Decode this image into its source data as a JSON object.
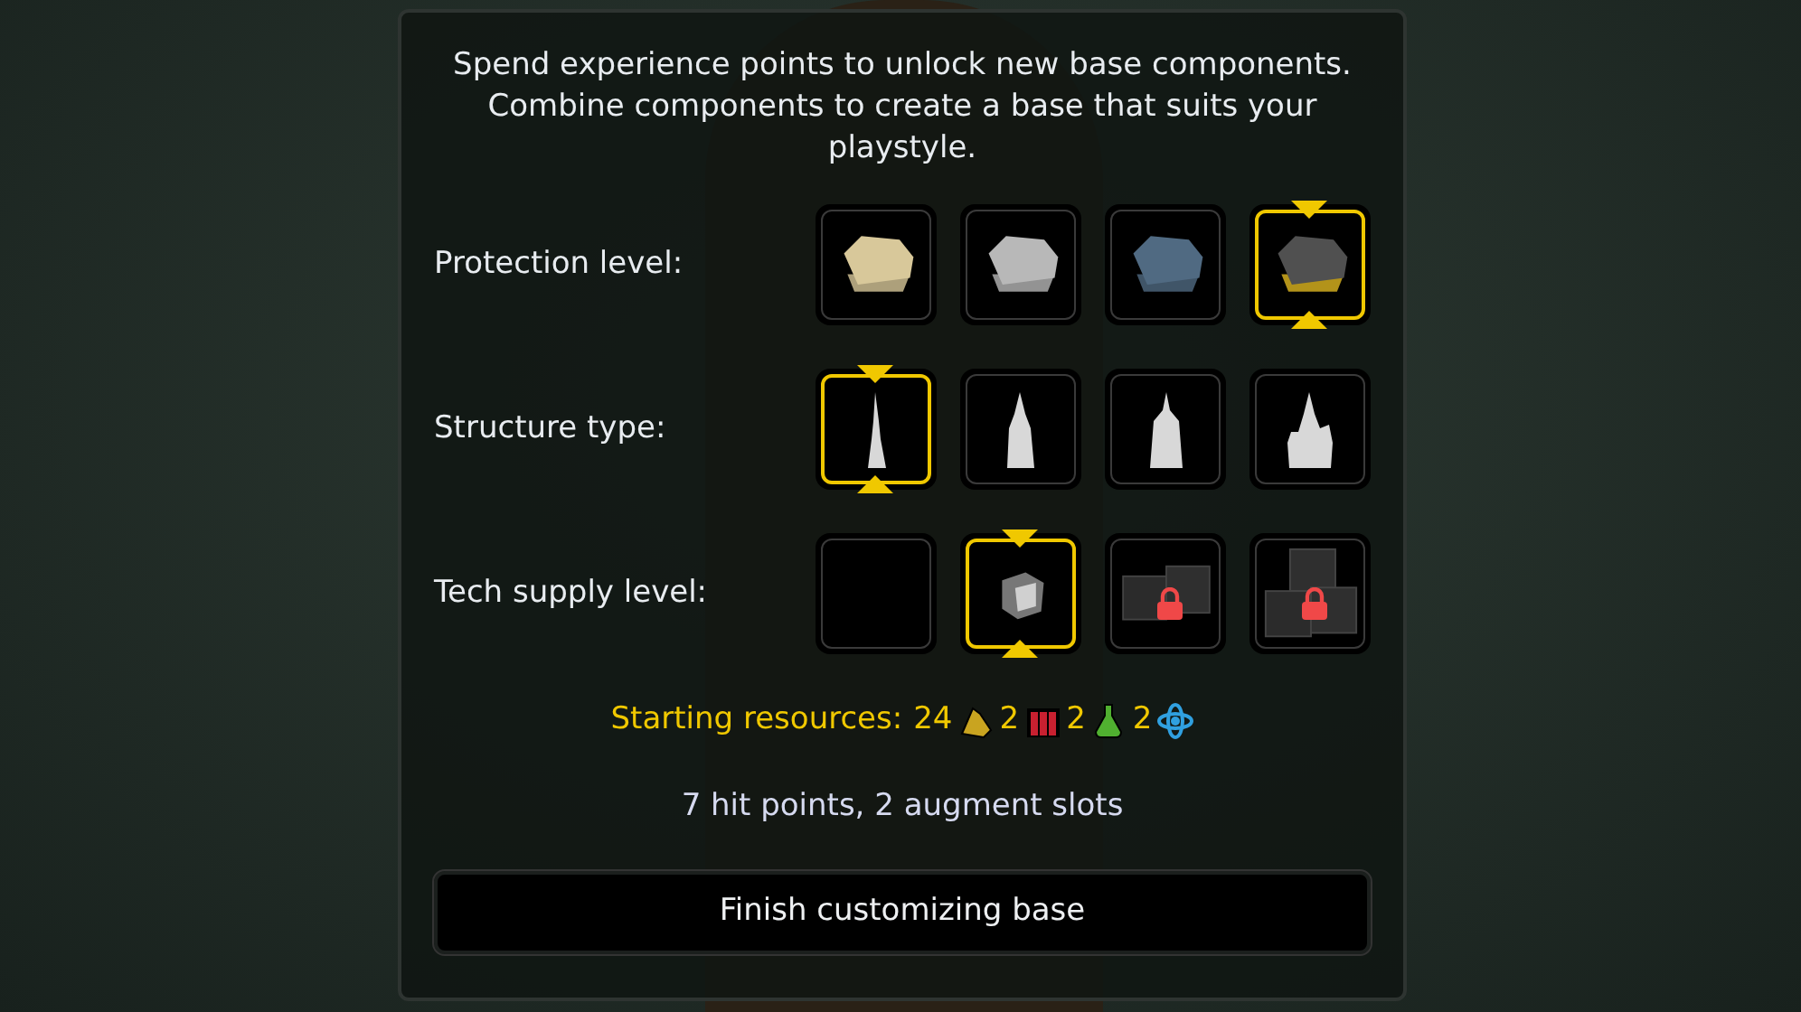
{
  "intro": "Spend experience points to unlock new base components. Combine components to create a base that suits your playstyle.",
  "rows": [
    {
      "label": "Protection level:",
      "options": [
        {
          "kind": "plate",
          "color": "#d8c89a",
          "selected": false,
          "locked": false
        },
        {
          "kind": "plate",
          "color": "#b8b8b8",
          "selected": false,
          "locked": false
        },
        {
          "kind": "plate",
          "color": "#506a82",
          "selected": false,
          "locked": false
        },
        {
          "kind": "plate",
          "color": "#505050",
          "selected": true,
          "locked": false
        }
      ]
    },
    {
      "label": "Structure type:",
      "options": [
        {
          "kind": "spire",
          "selected": true,
          "locked": false
        },
        {
          "kind": "tower",
          "selected": false,
          "locked": false
        },
        {
          "kind": "keep",
          "selected": false,
          "locked": false
        },
        {
          "kind": "castle",
          "selected": false,
          "locked": false
        }
      ]
    },
    {
      "label": "Tech supply level:",
      "options": [
        {
          "kind": "empty",
          "selected": false,
          "locked": false
        },
        {
          "kind": "crate",
          "selected": true,
          "locked": false
        },
        {
          "kind": "crates",
          "selected": false,
          "locked": true
        },
        {
          "kind": "crate-pile",
          "selected": false,
          "locked": true
        }
      ]
    }
  ],
  "resources": {
    "label": "Starting resources:",
    "items": [
      {
        "amount": "24",
        "kind": "rock"
      },
      {
        "amount": "2",
        "kind": "dynamite"
      },
      {
        "amount": "2",
        "kind": "potion"
      },
      {
        "amount": "2",
        "kind": "atom"
      }
    ]
  },
  "summary": "7 hit points, 2 augment slots",
  "finish_button": "Finish customizing base"
}
